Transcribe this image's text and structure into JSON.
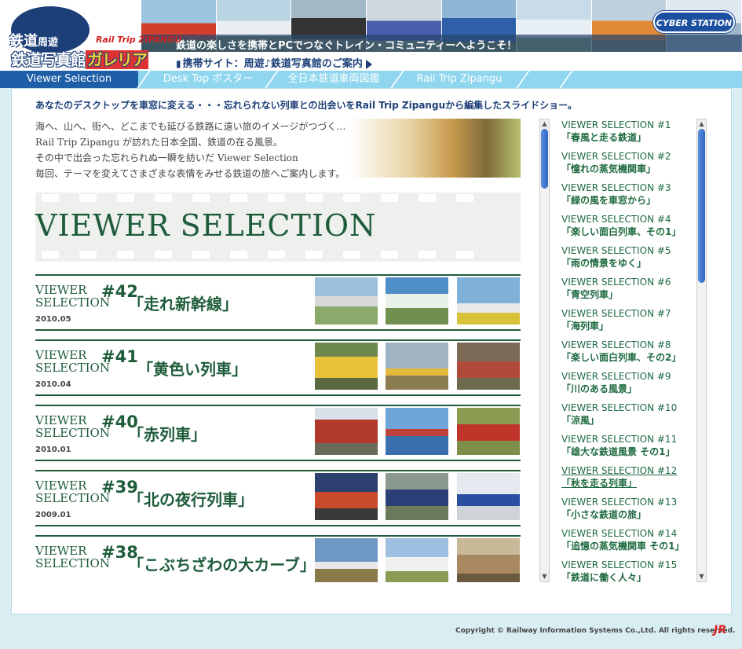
{
  "header": {
    "logo": {
      "small": "周遊",
      "kanji": "鉄道",
      "main": "鉄道写真館",
      "galleria": "ガレリア",
      "rail_trip": "Rail Trip ZIPANGU"
    },
    "tagline": "鉄道の楽しさを携帯とPCでつなぐトレイン・コミュニティーへようこそ！",
    "mobile_link": "携帯サイト：周遊♪鉄道写真館のご案内",
    "partner_logo": "CYBER STATION"
  },
  "nav": {
    "tabs": [
      {
        "label": "Viewer Selection",
        "active": true
      },
      {
        "label": "Desk Top ポスター",
        "active": false
      },
      {
        "label": "全日本鉄道車両図鑑",
        "active": false
      },
      {
        "label": "Rail Trip Zipangu",
        "active": false
      }
    ]
  },
  "main": {
    "lead": "あなたのデスクトップを車窓に変える・・・忘れられない列車との出会いをRail Trip Zipanguから編集したスライドショー。",
    "intro_lines": [
      "海へ、山へ、街へ、どこまでも延びる鉄路に遠い旅のイメージがつづく…",
      "Rail Trip Zipangu が訪れた日本全国、鉄道の在る風景。",
      "その中で出会った忘れられぬ一瞬を紡いだ Viewer Selection",
      "毎回、テーマを変えてさまざまな表情をみせる鉄道の旅へご案内します。"
    ],
    "banner_title": "VIEWER SELECTION",
    "entries": [
      {
        "label_1": "VIEWER",
        "label_2": "SELECTION",
        "number": "#42",
        "date": "2010.05",
        "title": "「走れ新幹線」",
        "thumbs": [
          "#8aa96a",
          "#4f8fc7",
          "#7fb0d8"
        ]
      },
      {
        "label_1": "VIEWER",
        "label_2": "SELECTION",
        "number": "#41",
        "date": "2010.04",
        "title": "「黄色い列車」",
        "thumbs": [
          "#6d8a4c",
          "#9fb3c2",
          "#7a6a56"
        ]
      },
      {
        "label_1": "VIEWER",
        "label_2": "SELECTION",
        "number": "#40",
        "date": "2010.01",
        "title": "「赤列車」",
        "thumbs": [
          "#b23a2a",
          "#6fa6d9",
          "#8a9c52"
        ]
      },
      {
        "label_1": "VIEWER",
        "label_2": "SELECTION",
        "number": "#39",
        "date": "2009.01",
        "title": "「北の夜行列車」",
        "thumbs": [
          "#2c3f6e",
          "#8a9a8e",
          "#e6eaf0"
        ]
      },
      {
        "label_1": "VIEWER",
        "label_2": "SELECTION",
        "number": "#38",
        "date": "",
        "title": "「こぶちざわの大カーブ」",
        "thumbs": [
          "#6f97c4",
          "#9ebfe0",
          "#a98a60"
        ]
      }
    ]
  },
  "sidebar": {
    "items": [
      {
        "line1": "VIEWER SELECTION #1",
        "line2": "「春風と走る鉄道」"
      },
      {
        "line1": "VIEWER SELECTION #2",
        "line2": "「憧れの蒸気機関車」"
      },
      {
        "line1": "VIEWER SELECTION #3",
        "line2": "「緑の風を車窓から」"
      },
      {
        "line1": "VIEWER SELECTION #4",
        "line2": "「楽しい面白列車、その1」"
      },
      {
        "line1": "VIEWER SELECTION #5",
        "line2": "「雨の情景をゆく」"
      },
      {
        "line1": "VIEWER SELECTION #6",
        "line2": "「青空列車」"
      },
      {
        "line1": "VIEWER SELECTION #7",
        "line2": "「海列車」"
      },
      {
        "line1": "VIEWER SELECTION #8",
        "line2": "「楽しい面白列車、その2」"
      },
      {
        "line1": "VIEWER SELECTION #9",
        "line2": "「川のある風景」"
      },
      {
        "line1": "VIEWER SELECTION #10",
        "line2": "「涼風」"
      },
      {
        "line1": "VIEWER SELECTION #11",
        "line2": "「雄大な鉄道風景 その1」"
      },
      {
        "line1": "VIEWER SELECTION #12",
        "line2": "「秋を走る列車」",
        "underlined": true
      },
      {
        "line1": "VIEWER SELECTION #13",
        "line2": "「小さな鉄道の旅」"
      },
      {
        "line1": "VIEWER SELECTION #14",
        "line2": "「追憶の蒸気機関車 その1」"
      },
      {
        "line1": "VIEWER SELECTION #15",
        "line2": "「鉄道に働く人々」"
      }
    ]
  },
  "footer": {
    "copyright": "Copyright ©  Railway Information Systems Co.,Ltd. All rights reserved.",
    "jr_logo": "JR"
  },
  "colors": {
    "brand_green": "#1e5c3a",
    "nav_active": "#1f5fa8",
    "nav_bar": "#8fd6ee",
    "background": "#d9eef3"
  }
}
